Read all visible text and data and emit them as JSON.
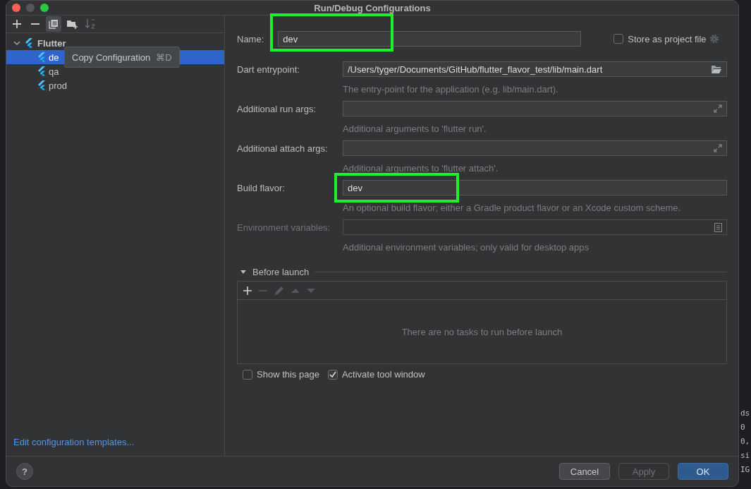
{
  "window": {
    "title": "Run/Debug Configurations"
  },
  "toolbar": [
    {
      "kind": "add",
      "disabled": false
    },
    {
      "kind": "remove",
      "disabled": false
    },
    {
      "kind": "copy",
      "disabled": false,
      "selected": true
    },
    {
      "kind": "folder",
      "disabled": false
    },
    {
      "kind": "sort",
      "disabled": true
    }
  ],
  "tree": [
    {
      "label": "Flutter",
      "expanded": true,
      "selected": false,
      "children": [
        {
          "label": "de",
          "selected": true
        },
        {
          "label": "qa",
          "selected": false
        },
        {
          "label": "prod",
          "selected": false
        }
      ]
    }
  ],
  "tooltip": {
    "label": "Copy Configuration",
    "shortcut": "⌘D"
  },
  "templates_link": "Edit configuration templates...",
  "name": {
    "label": "Name:",
    "value": "dev",
    "highlighted": true
  },
  "store_as_project_file": {
    "label": "Store as project file",
    "checked": false
  },
  "fields": [
    {
      "kind": "path",
      "label": "Dart entrypoint:",
      "value": "/Users/tyger/Documents/GitHub/flutter_flavor_test/lib/main.dart",
      "hint": "The entry-point for the application (e.g. lib/main.dart).",
      "disabled": false,
      "highlighted": false
    },
    {
      "kind": "expand",
      "label": "Additional run args:",
      "hint": "Additional arguments to 'flutter run'.",
      "disabled": false,
      "highlighted": false
    },
    {
      "kind": "expand",
      "label": "Additional attach args:",
      "hint": "Additional arguments to 'flutter attach'.",
      "disabled": false,
      "highlighted": false
    },
    {
      "kind": "text",
      "label": "Build flavor:",
      "value": "dev",
      "hint": "An optional build flavor; either a Gradle product flavor or an Xcode custom scheme.",
      "disabled": false,
      "highlighted": true
    },
    {
      "kind": "env",
      "label": "Environment variables:",
      "hint": "Additional environment variables; only valid for desktop apps",
      "disabled": true,
      "highlighted": false
    }
  ],
  "before_launch": {
    "title": "Before launch",
    "expanded": true,
    "tools": [
      {
        "kind": "add",
        "disabled": false
      },
      {
        "kind": "remove",
        "disabled": true
      },
      {
        "kind": "edit",
        "disabled": true
      },
      {
        "kind": "up",
        "disabled": true
      },
      {
        "kind": "down",
        "disabled": true
      }
    ],
    "empty_text": "There are no tasks to run before launch"
  },
  "options": [
    {
      "label": "Show this page",
      "checked": false
    },
    {
      "label": "Activate tool window",
      "checked": true
    }
  ],
  "buttons": [
    {
      "label": "Cancel",
      "kind": "normal",
      "disabled": false
    },
    {
      "label": "Apply",
      "kind": "normal",
      "disabled": true
    },
    {
      "label": "OK",
      "kind": "default",
      "disabled": false
    }
  ],
  "help": {
    "label": "?"
  },
  "background_code": [
    "ds",
    "0",
    "0,",
    "si",
    "IG"
  ]
}
